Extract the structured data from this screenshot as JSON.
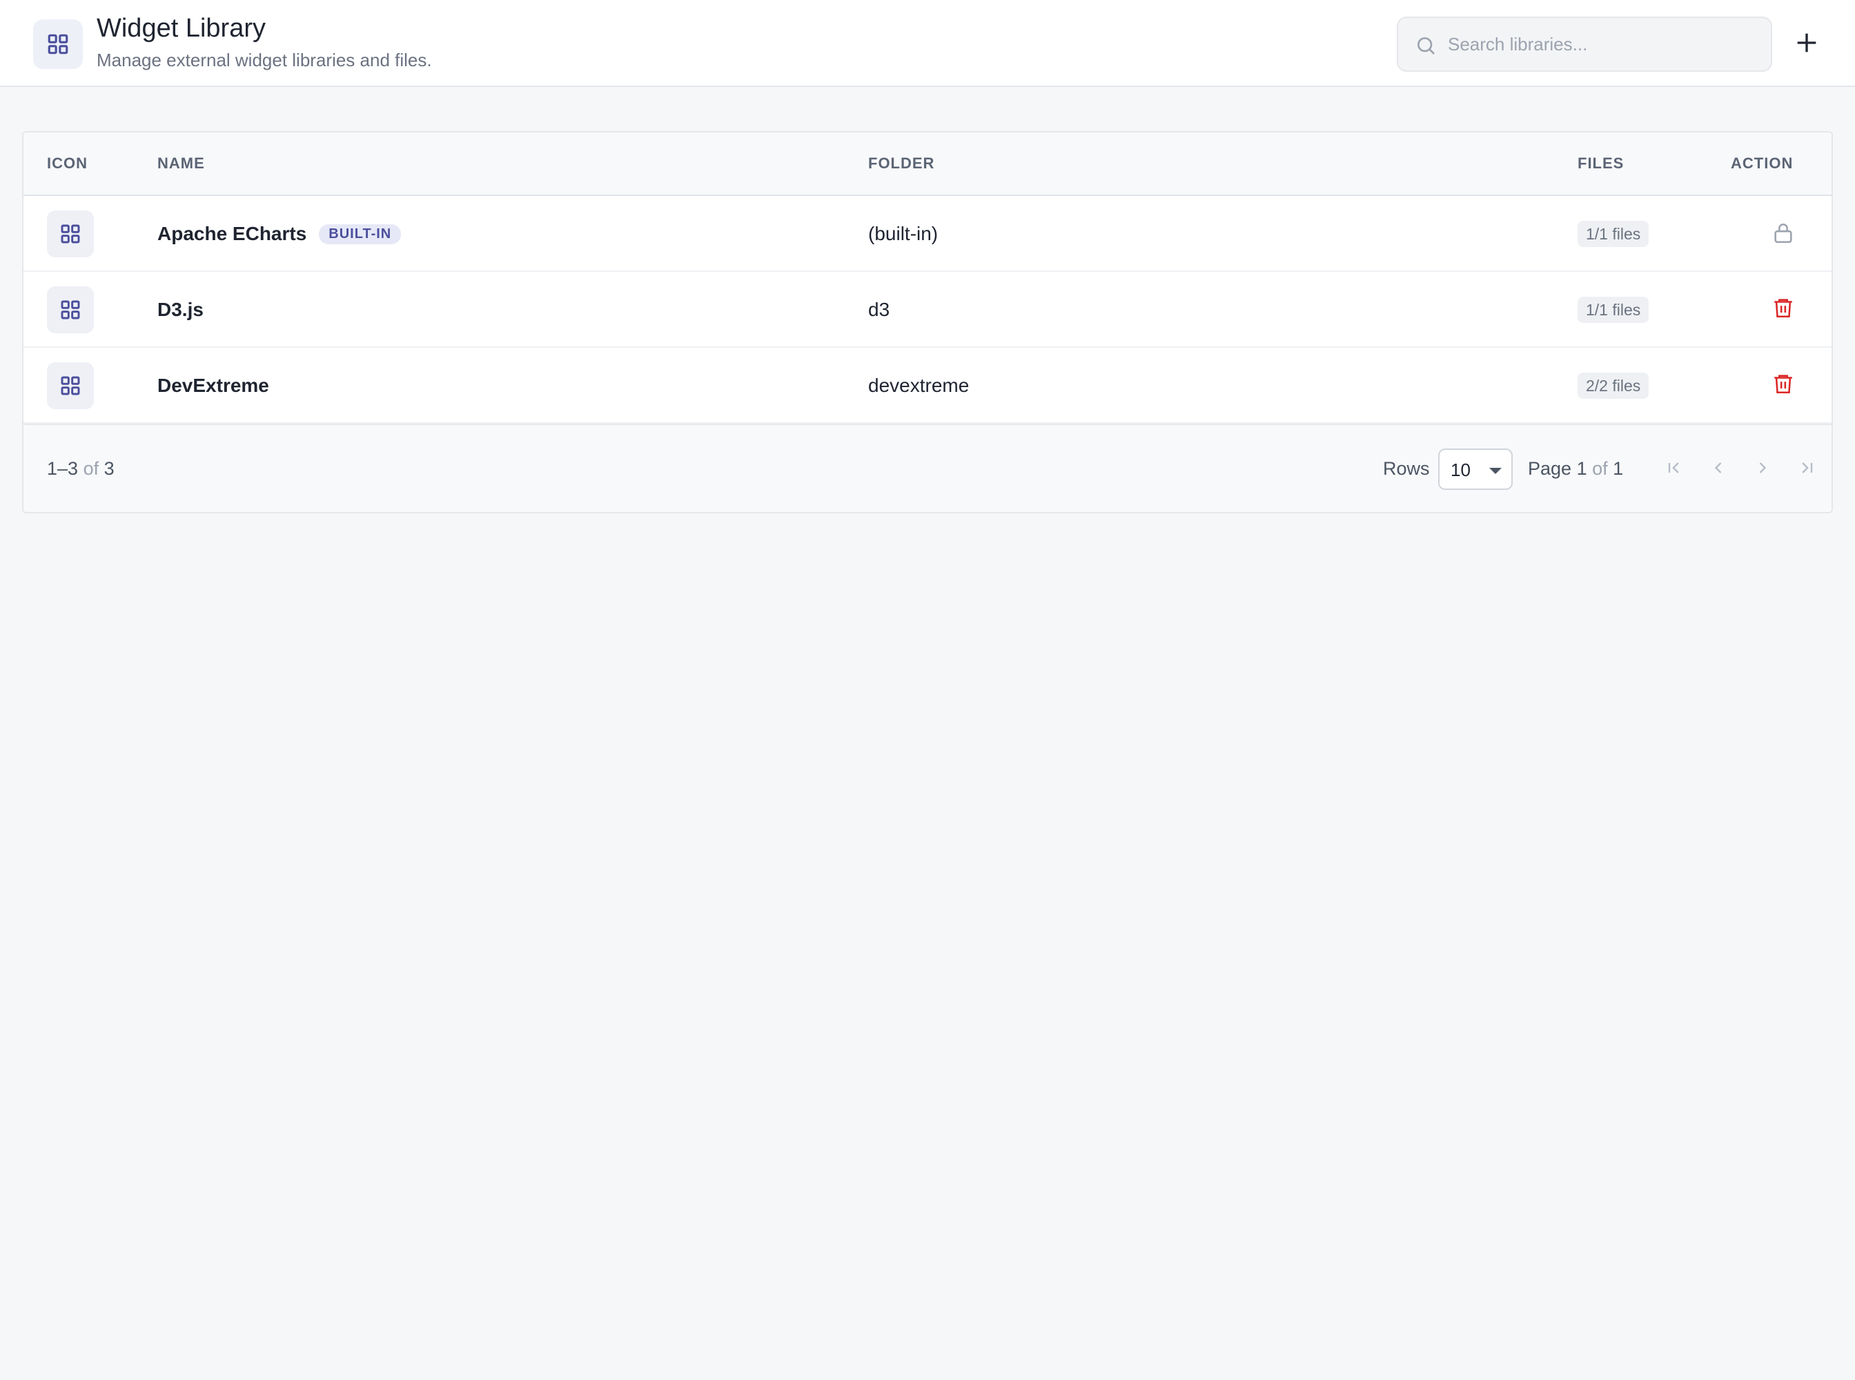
{
  "header": {
    "title": "Widget Library",
    "subtitle": "Manage external widget libraries and files.",
    "icon": "grid-icon"
  },
  "search": {
    "placeholder": "Search libraries...",
    "value": "",
    "icon": "search-icon"
  },
  "add_button": {
    "icon": "plus-icon"
  },
  "table": {
    "columns": {
      "icon": "ICON",
      "name": "NAME",
      "folder": "FOLDER",
      "files": "FILES",
      "action": "ACTION"
    },
    "rows": [
      {
        "name": "Apache ECharts",
        "badge": "BUILT-IN",
        "folder": "(built-in)",
        "files": "1/1 files",
        "action_icon": "lock-icon"
      },
      {
        "name": "D3.js",
        "badge": "",
        "folder": "d3",
        "files": "1/1 files",
        "action_icon": "trash-icon"
      },
      {
        "name": "DevExtreme",
        "badge": "",
        "folder": "devextreme",
        "files": "2/2 files",
        "action_icon": "trash-icon"
      }
    ]
  },
  "pagination": {
    "range": "1–3",
    "of_label": "of",
    "total": "3",
    "rows_label": "Rows",
    "rows_per_page": "10",
    "page_label": "Page",
    "current_page": "1",
    "page_of_label": "of",
    "total_pages": "1"
  },
  "colors": {
    "accent": "#4b4f9c",
    "danger": "#dc2626",
    "muted_icon": "#9ca3af"
  }
}
